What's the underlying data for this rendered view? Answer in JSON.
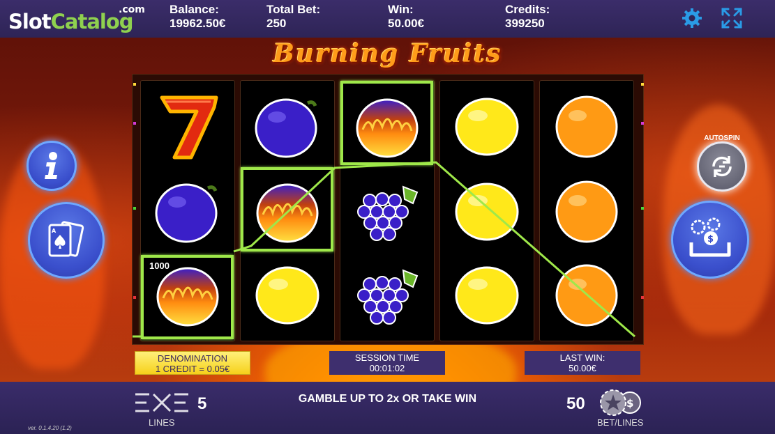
{
  "brand": {
    "logo_part1": "Slot",
    "logo_part2": "Catalog",
    "logo_suffix": ".com"
  },
  "header": {
    "balance_label": "Balance:",
    "balance_value": "19962.50€",
    "totalbet_label": "Total Bet:",
    "totalbet_value": "250",
    "win_label": "Win:",
    "win_value": "50.00€",
    "credits_label": "Credits:",
    "credits_value": "399250",
    "icons": [
      "gear-icon",
      "fullscreen-icon"
    ]
  },
  "game": {
    "title": "Burning Fruits"
  },
  "reels": {
    "grid": [
      [
        "seven",
        "plum",
        "burning-fruit"
      ],
      [
        "plum",
        "burning-fruit",
        "lemon"
      ],
      [
        "burning-fruit",
        "grapes",
        "grapes"
      ],
      [
        "lemon",
        "lemon",
        "lemon"
      ],
      [
        "orange",
        "orange",
        "orange"
      ]
    ],
    "win_amount_tag": "1000",
    "colors": {
      "highlight": "#9fe84a",
      "reel_bg": "#000000"
    }
  },
  "panels": {
    "denomination_label": "DENOMINATION",
    "denomination_value": "1 CREDIT = 0.05€",
    "session_label": "SESSION TIME",
    "session_value": "00:01:02",
    "lastwin_label": "LAST WIN:",
    "lastwin_value": "50.00€"
  },
  "side": {
    "autospin_label": "AUTOSPIN"
  },
  "bottom": {
    "lines_value": "5",
    "lines_label": "LINES",
    "gamble_text": "GAMBLE UP TO 2x OR TAKE WIN",
    "bet_value": "50",
    "bet_label": "BET/LINES",
    "version": "ver. 0.1.4.20 (1.2)"
  }
}
